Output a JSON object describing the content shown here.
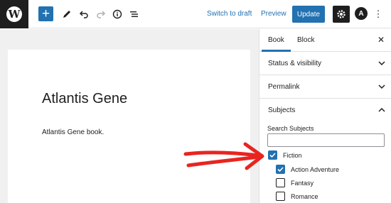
{
  "toolbar": {
    "logo_glyph": "W",
    "add_glyph": "+",
    "switch_to_draft_label": "Switch to draft",
    "preview_label": "Preview",
    "update_label": "Update",
    "astra_glyph": "A",
    "more_glyph": "⋮"
  },
  "post": {
    "title": "Atlantis Gene",
    "body": "Atlantis Gene book."
  },
  "sidebar": {
    "tabs": [
      {
        "label": "Book",
        "active": true
      },
      {
        "label": "Block",
        "active": false
      }
    ],
    "close_glyph": "✕",
    "panels": [
      {
        "label": "Status & visibility",
        "expanded": false
      },
      {
        "label": "Permalink",
        "expanded": false
      },
      {
        "label": "Subjects",
        "expanded": true
      }
    ],
    "subjects": {
      "search_label": "Search Subjects",
      "search_value": "",
      "items": [
        {
          "label": "Fiction",
          "checked": true,
          "child": false
        },
        {
          "label": "Action Adventure",
          "checked": true,
          "child": true
        },
        {
          "label": "Fantasy",
          "checked": false,
          "child": true
        },
        {
          "label": "Romance",
          "checked": false,
          "child": true
        }
      ]
    }
  },
  "colors": {
    "accent": "#2271b1",
    "dark": "#1e1e1e",
    "annotation_arrow": "#e8251f"
  }
}
